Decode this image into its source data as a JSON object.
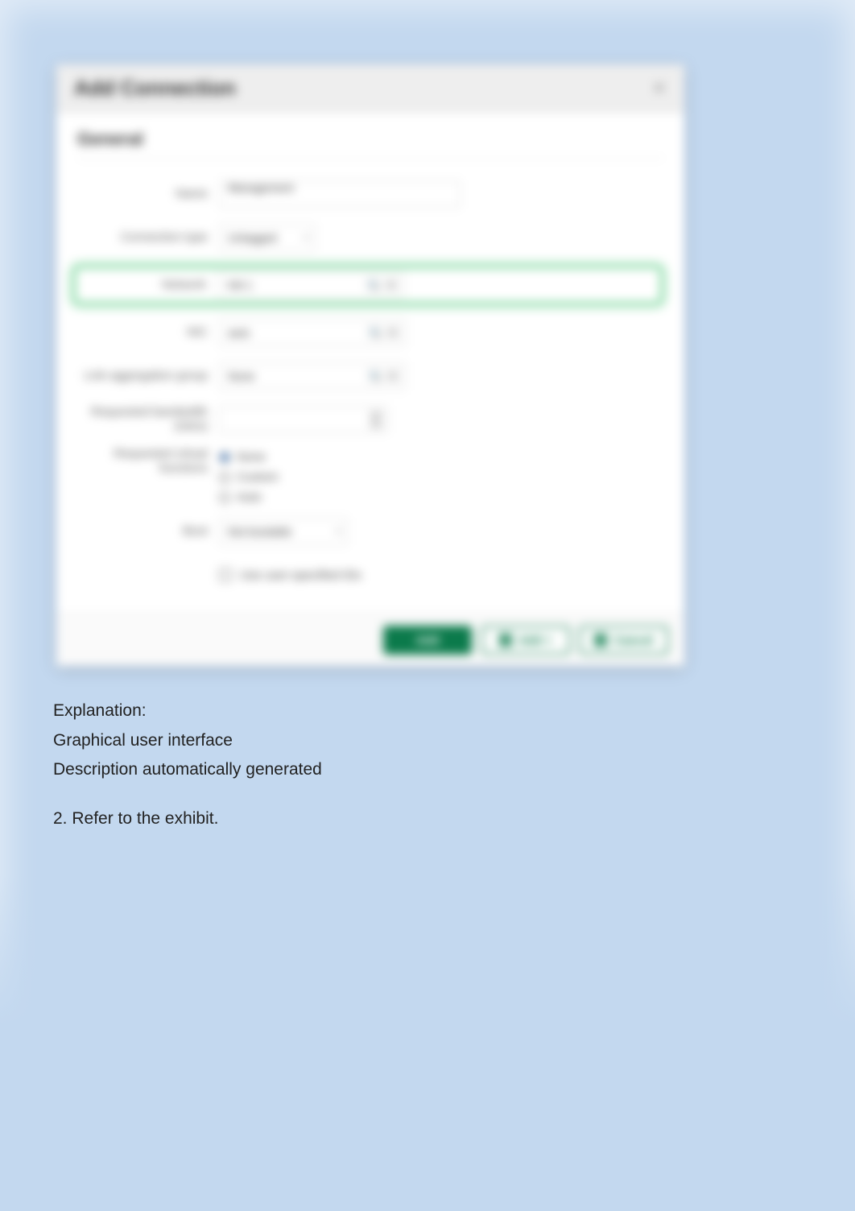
{
  "dialog": {
    "title": "Add Connection",
    "section": "General",
    "name_label": "Name",
    "name_value": "Management",
    "conn_type_label": "Connection type",
    "conn_type_value": "Untagged",
    "network_label": "Network",
    "network_value": "VM 1",
    "nic_label": "NIC",
    "nic_value": "auto",
    "link_aggr_label": "Link aggregation group",
    "link_aggr_value": "None",
    "bw_label": "Requested bandwidth (Gb/s)",
    "virt_label": "Requested virtual functions",
    "virt_opts": {
      "a": "None",
      "b": "Custom",
      "c": "Auto"
    },
    "boot_label": "Boot",
    "boot_value": "Not bootable",
    "mac_checkbox": "Use user-specified IDs"
  },
  "footer": {
    "add": "Add",
    "add_again": "Add +",
    "cancel": "Cancel"
  },
  "explanation": {
    "title": "Explanation:",
    "line1": "Graphical user interface",
    "line2": "Description automatically generated",
    "q2": "2. Refer to the exhibit."
  }
}
